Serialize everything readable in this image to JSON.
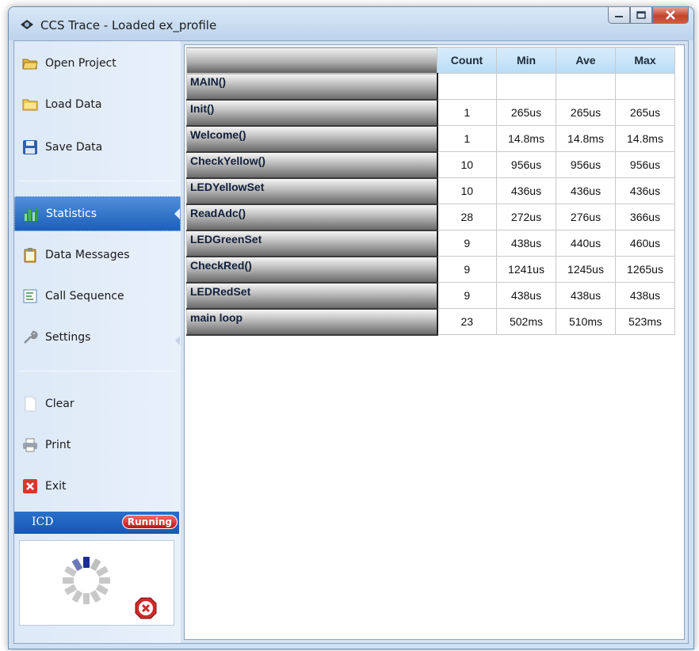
{
  "window": {
    "title": "CCS Trace - Loaded ex_profile"
  },
  "sidebar": {
    "items": [
      {
        "label": "Open Project",
        "icon": "folder-open-icon"
      },
      {
        "label": "Load Data",
        "icon": "folder-icon"
      },
      {
        "label": "Save Data",
        "icon": "floppy-disk-icon"
      },
      {
        "label": "Statistics",
        "icon": "bar-chart-icon",
        "active": true
      },
      {
        "label": "Data Messages",
        "icon": "clipboard-icon"
      },
      {
        "label": "Call Sequence",
        "icon": "sequence-list-icon"
      },
      {
        "label": "Settings",
        "icon": "wrench-icon"
      },
      {
        "label": "Clear",
        "icon": "blank-page-icon"
      },
      {
        "label": "Print",
        "icon": "printer-icon"
      },
      {
        "label": "Exit",
        "icon": "exit-x-icon"
      }
    ]
  },
  "icd": {
    "label": "ICD",
    "status": "Running"
  },
  "stats": {
    "columns": [
      "Count",
      "Min",
      "Ave",
      "Max"
    ],
    "rows": [
      {
        "name": "MAIN()",
        "count": "",
        "min": "",
        "ave": "",
        "max": ""
      },
      {
        "name": "Init()",
        "count": "1",
        "min": "265us",
        "ave": "265us",
        "max": "265us"
      },
      {
        "name": "Welcome()",
        "count": "1",
        "min": "14.8ms",
        "ave": "14.8ms",
        "max": "14.8ms"
      },
      {
        "name": "CheckYellow()",
        "count": "10",
        "min": "956us",
        "ave": "956us",
        "max": "956us"
      },
      {
        "name": "LEDYellowSet",
        "count": "10",
        "min": "436us",
        "ave": "436us",
        "max": "436us"
      },
      {
        "name": "ReadAdc()",
        "count": "28",
        "min": "272us",
        "ave": "276us",
        "max": "366us"
      },
      {
        "name": "LEDGreenSet",
        "count": "9",
        "min": "438us",
        "ave": "440us",
        "max": "460us"
      },
      {
        "name": "CheckRed()",
        "count": "9",
        "min": "1241us",
        "ave": "1245us",
        "max": "1265us"
      },
      {
        "name": "LEDRedSet",
        "count": "9",
        "min": "438us",
        "ave": "438us",
        "max": "438us"
      },
      {
        "name": "main loop",
        "count": "23",
        "min": "502ms",
        "ave": "510ms",
        "max": "523ms"
      }
    ]
  },
  "colors": {
    "accent": "#1c5fba",
    "running": "#c11212"
  }
}
